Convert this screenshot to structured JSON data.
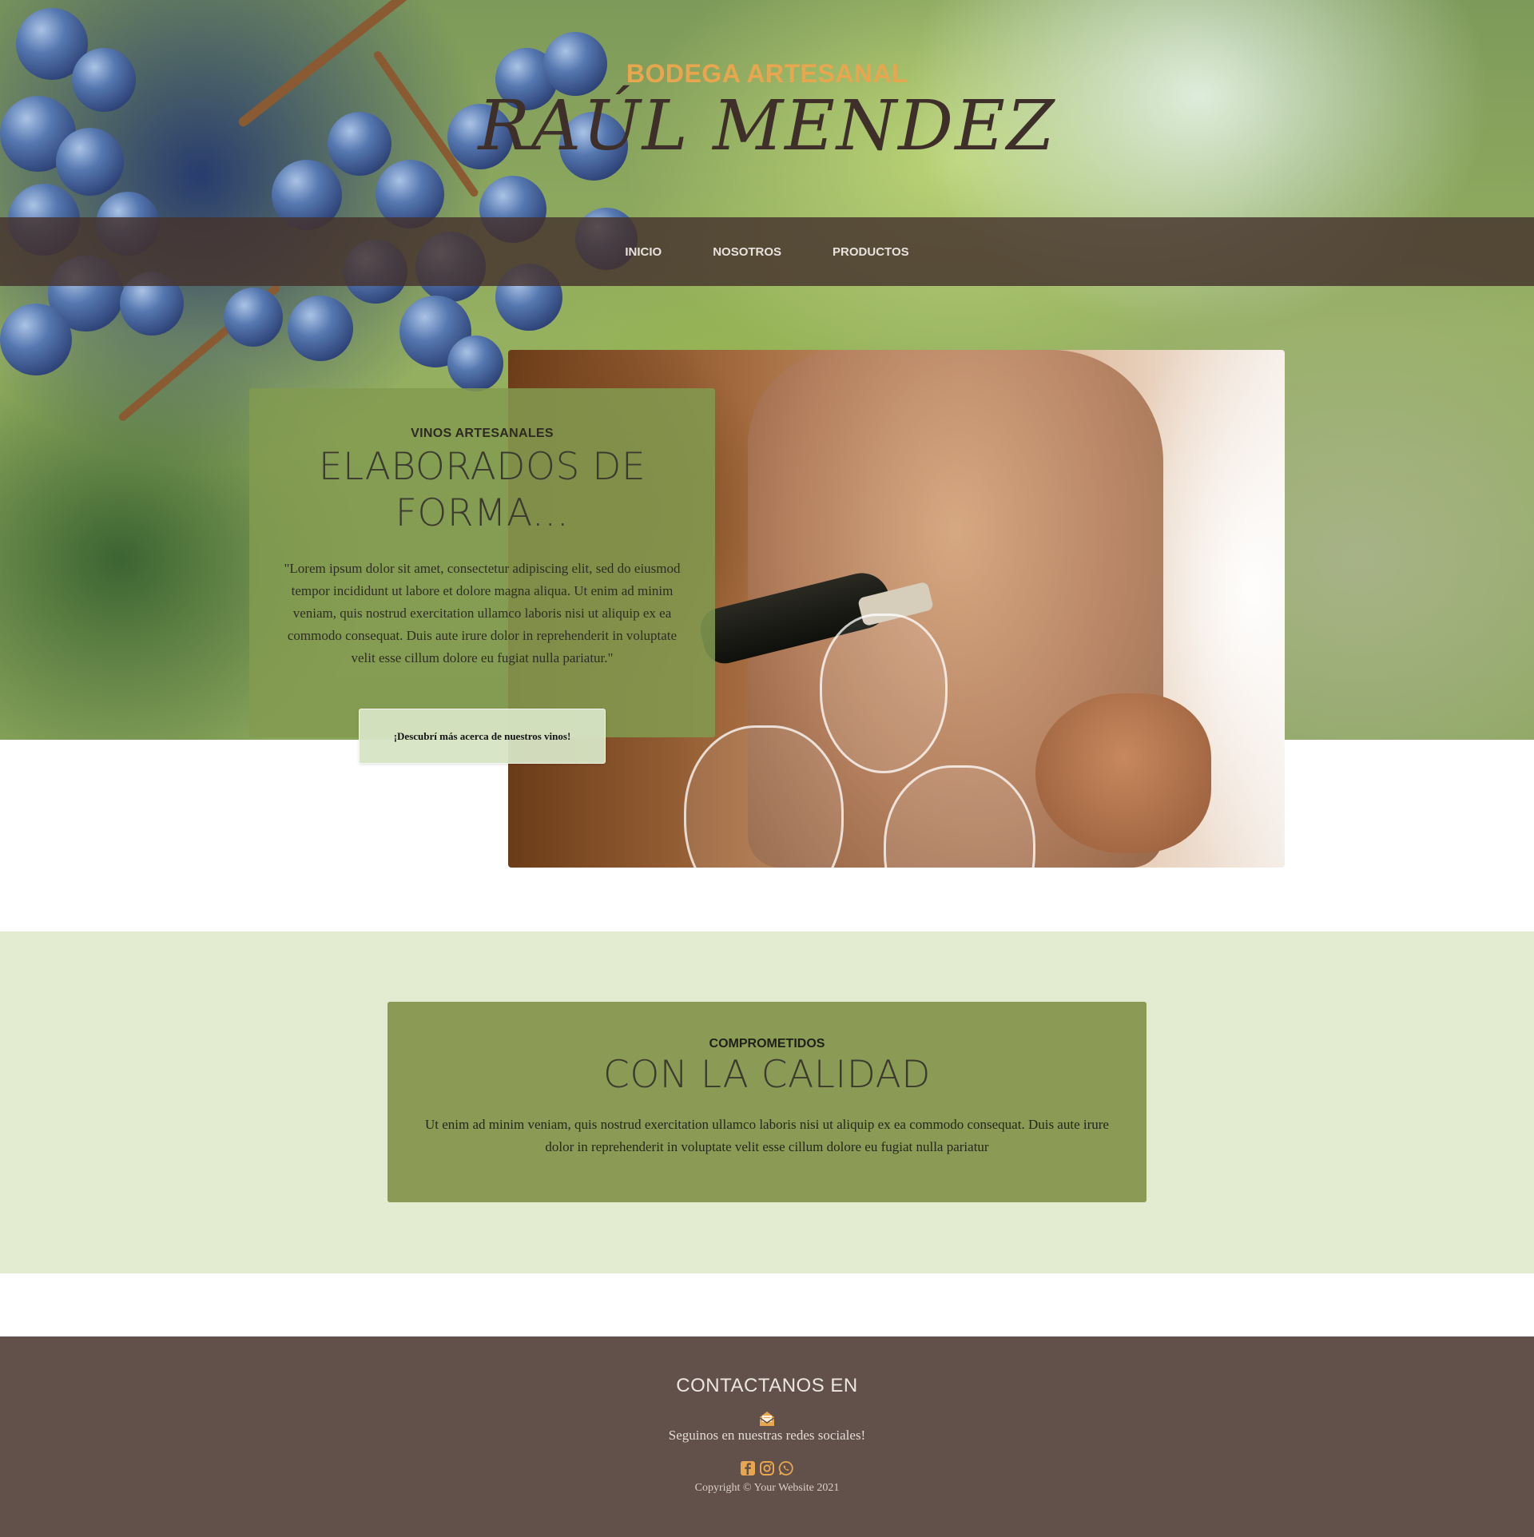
{
  "header": {
    "brand_subtitle": "BODEGA ARTESANAL",
    "brand_name": "RAÚL MENDEZ"
  },
  "nav": {
    "items": [
      {
        "label": "INICIO"
      },
      {
        "label": "NOSOTROS"
      },
      {
        "label": "PRODUCTOS"
      }
    ]
  },
  "hero": {
    "eyebrow": "VINOS ARTESANALES",
    "heading_line1": "ELABORADOS DE",
    "heading_line2": "FORMA...",
    "paragraph": "\"Lorem ipsum dolor sit amet, consectetur adipiscing elit, sed do eiusmod tempor incididunt ut labore et dolore magna aliqua. Ut enim ad minim veniam, quis nostrud exercitation ullamco laboris nisi ut aliquip ex ea commodo consequat. Duis aute irure dolor in reprehenderit in voluptate velit esse cillum dolore eu fugiat nulla pariatur.\"",
    "cta_label": "¡Descubrí más acerca de nuestros vinos!"
  },
  "quality": {
    "eyebrow": "COMPROMETIDOS",
    "heading": "CON LA CALIDAD",
    "paragraph": "Ut enim ad minim veniam, quis nostrud exercitation ullamco laboris nisi ut aliquip ex ea commodo consequat. Duis aute irure dolor in reprehenderit in voluptate velit esse cillum dolore eu fugiat nulla pariatur"
  },
  "footer": {
    "title": "CONTACTANOS EN",
    "icons": [
      "mail-icon",
      "facebook-icon",
      "instagram-icon",
      "whatsapp-icon"
    ],
    "social_text": "Seguinos en nuestras redes sociales!",
    "copyright": "Copyright © Your Website 2021"
  },
  "colors": {
    "accent": "#e8a64e",
    "brand_text": "#3e2f2a",
    "nav_bg": "#46322d",
    "card_green": "#829b50",
    "quality_bg": "#e3ebd0",
    "quality_card": "#8b9a55",
    "footer_bg": "#62504a"
  }
}
